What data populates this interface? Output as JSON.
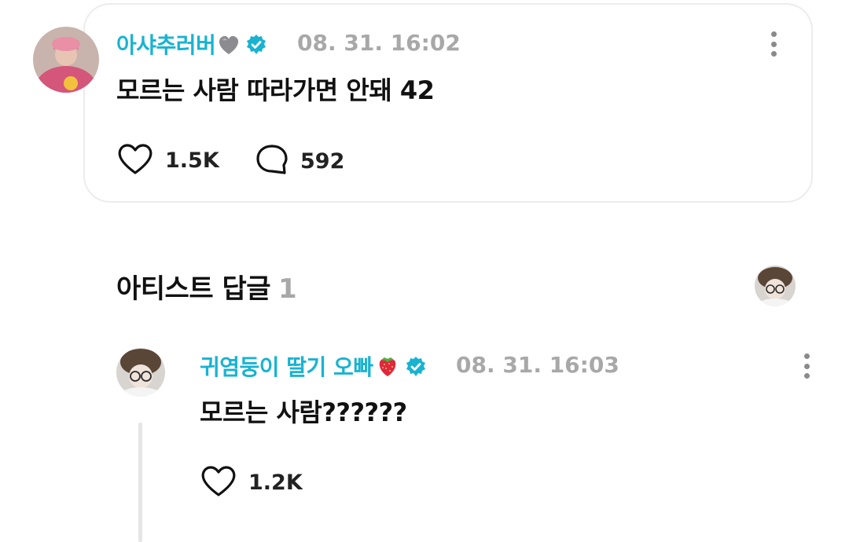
{
  "post": {
    "username": "아샤추러버",
    "username_emoji": "grey-heart-icon",
    "timestamp": "08. 31. 16:02",
    "text": "모르는 사람 따라가면 안돼 42",
    "likes": "1.5K",
    "comments": "592"
  },
  "artist_replies": {
    "title": "아티스트 답글",
    "count": "1"
  },
  "reply": {
    "username": "귀염둥이 딸기 오빠",
    "username_emoji": "strawberry-icon",
    "timestamp": "08. 31. 16:03",
    "text": "모르는 사람??????",
    "likes": "1.2K"
  },
  "colors": {
    "username": "#19b3d1",
    "verified": "#19b3d1",
    "timestamp": "#a8a8a8",
    "text": "#111111",
    "card_border": "#ececec"
  }
}
